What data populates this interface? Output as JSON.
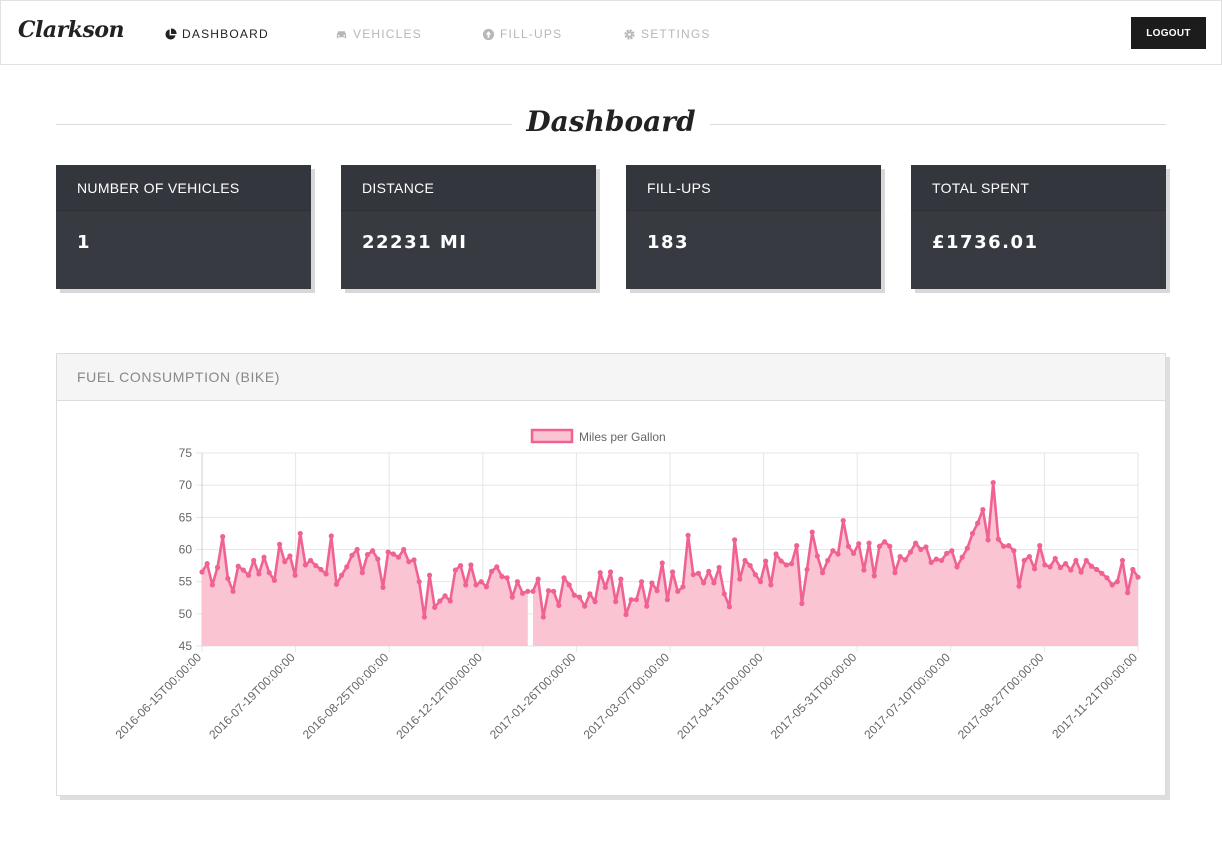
{
  "nav": {
    "brand": "Clarkson",
    "items": [
      {
        "label": "DASHBOARD",
        "icon": "pie-chart-icon",
        "active": true
      },
      {
        "label": "VEHICLES",
        "icon": "car-icon",
        "active": false
      },
      {
        "label": "FILL-UPS",
        "icon": "arrow-up-circle-icon",
        "active": false
      },
      {
        "label": "SETTINGS",
        "icon": "gear-icon",
        "active": false
      }
    ],
    "logout_label": "LOGOUT"
  },
  "page": {
    "title": "Dashboard"
  },
  "stats": [
    {
      "label": "NUMBER OF VEHICLES",
      "value": "1"
    },
    {
      "label": "DISTANCE",
      "value": "22231 MI"
    },
    {
      "label": "FILL-UPS",
      "value": "183"
    },
    {
      "label": "TOTAL SPENT",
      "value": "£1736.01"
    }
  ],
  "panel": {
    "title": "FUEL CONSUMPTION (BIKE)"
  },
  "colors": {
    "line": "#f06292",
    "fill": "#fbc4d3",
    "dark_card": "#383a41"
  },
  "chart_data": {
    "type": "area",
    "legend": "Miles per Gallon",
    "ylim": [
      45,
      75
    ],
    "yticks": [
      45,
      50,
      55,
      60,
      65,
      70,
      75
    ],
    "xticks": [
      "2016-06-15T00:00:00",
      "2016-07-19T00:00:00",
      "2016-08-25T00:00:00",
      "2016-12-12T00:00:00",
      "2017-01-26T00:00:00",
      "2017-03-07T00:00:00",
      "2017-04-13T00:00:00",
      "2017-05-31T00:00:00",
      "2017-07-10T00:00:00",
      "2017-08-27T00:00:00",
      "2017-11-21T00:00:00"
    ],
    "gap_after_index": 63,
    "values": [
      56.5,
      57.8,
      54.5,
      57.2,
      62.0,
      55.5,
      53.5,
      57.4,
      56.8,
      56.0,
      58.3,
      56.2,
      58.8,
      56.4,
      55.2,
      60.8,
      58.1,
      59.0,
      56.0,
      62.5,
      57.6,
      58.3,
      57.5,
      56.9,
      56.2,
      62.1,
      54.6,
      56.0,
      57.3,
      59.1,
      60.0,
      56.4,
      59.2,
      59.8,
      58.5,
      54.1,
      59.6,
      59.3,
      58.8,
      60.0,
      58.1,
      58.4,
      55.0,
      49.5,
      56.0,
      51.0,
      52.0,
      52.8,
      52.0,
      56.8,
      57.5,
      54.5,
      57.6,
      54.5,
      55.0,
      54.2,
      56.6,
      57.3,
      55.8,
      55.6,
      52.6,
      55.0,
      53.2,
      53.5,
      53.5,
      55.4,
      49.5,
      53.6,
      53.5,
      51.3,
      55.6,
      54.5,
      52.9,
      52.6,
      51.2,
      53.1,
      51.9,
      56.4,
      54.1,
      56.5,
      51.9,
      55.4,
      49.9,
      52.2,
      52.2,
      55.0,
      51.2,
      54.8,
      53.6,
      57.9,
      52.2,
      56.5,
      53.5,
      54.2,
      62.2,
      56.1,
      56.3,
      54.8,
      56.6,
      54.8,
      57.2,
      53.1,
      51.1,
      61.5,
      55.4,
      58.3,
      57.5,
      56.1,
      55.0,
      58.2,
      54.5,
      59.3,
      58.2,
      57.6,
      57.8,
      60.6,
      51.6,
      56.9,
      62.7,
      59.0,
      56.4,
      58.3,
      59.8,
      59.3,
      64.5,
      60.5,
      59.4,
      60.9,
      56.8,
      61.0,
      55.9,
      60.5,
      61.2,
      60.5,
      56.4,
      58.9,
      58.4,
      59.6,
      61.0,
      60.0,
      60.4,
      58.0,
      58.5,
      58.3,
      59.4,
      59.8,
      57.3,
      58.8,
      60.2,
      62.5,
      64.1,
      66.2,
      61.5,
      70.4,
      61.6,
      60.5,
      60.6,
      59.8,
      54.3,
      58.3,
      58.9,
      57.0,
      60.6,
      57.6,
      57.3,
      58.6,
      57.2,
      57.8,
      56.8,
      58.3,
      56.5,
      58.3,
      57.4,
      56.9,
      56.3,
      55.6,
      54.5,
      55.0,
      58.3,
      53.3,
      56.9,
      55.7
    ]
  }
}
